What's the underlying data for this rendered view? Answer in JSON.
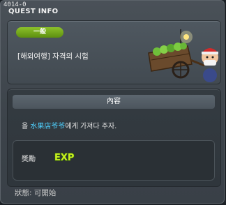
{
  "window": {
    "quest_id": "4014-0",
    "title": "QUEST INFO"
  },
  "header": {
    "badge": "一般",
    "quest_name": "[해외여행] 자격의 시험"
  },
  "content": {
    "section_title": "內容",
    "desc_prefix": "을 ",
    "npc_name": "水果店爷爷",
    "desc_suffix": "에게 가져다 주자."
  },
  "reward": {
    "label": "奬勵",
    "exp_text": "EXP"
  },
  "status": {
    "text": "狀態:  可開始"
  },
  "colors": {
    "badge": "#7bb21f",
    "highlight": "#4fd1ff",
    "exp": "#c8f020"
  }
}
